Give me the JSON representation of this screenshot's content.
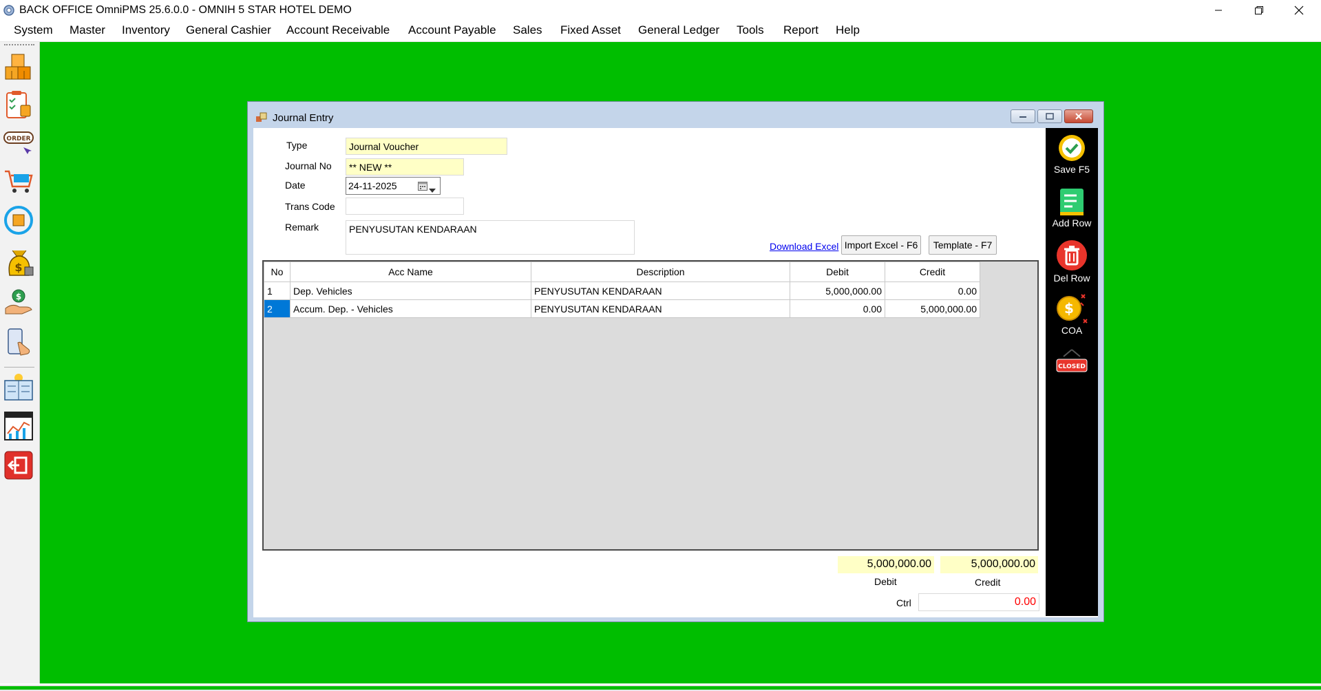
{
  "window": {
    "title": "BACK OFFICE OmniPMS 25.6.0.0 - OMNIH 5 STAR HOTEL DEMO"
  },
  "menu": [
    "System",
    "Master",
    "Inventory",
    "General Cashier",
    "Account Receivable",
    "Account Payable",
    "Sales",
    "Fixed Asset",
    "General Ledger",
    "Tools",
    "Report",
    "Help"
  ],
  "toolbar_icons": [
    "inventory-boxes-icon",
    "clipboard-checklist-icon",
    "order-icon",
    "shopping-cart-icon",
    "cycle-box-icon",
    "money-bag-icon",
    "hand-money-icon",
    "mobile-tap-icon",
    "ledger-book-icon",
    "chart-report-icon",
    "logout-icon"
  ],
  "journal": {
    "title": "Journal Entry",
    "labels": {
      "type": "Type",
      "journal_no": "Journal No",
      "date": "Date",
      "trans_code": "Trans Code",
      "remark": "Remark"
    },
    "values": {
      "type": "Journal Voucher",
      "journal_no": "** NEW **",
      "date": "24-11-2025",
      "trans_code": "",
      "remark": "PENYUSUTAN KENDARAAN"
    },
    "download_link": "Download Excel",
    "import_button": "Import Excel - F6",
    "template_button": "Template - F7",
    "grid": {
      "columns": [
        "No",
        "Acc Name",
        "Description",
        "Debit",
        "Credit"
      ],
      "rows": [
        {
          "no": "1",
          "acc_name": "Dep. Vehicles",
          "description": "PENYUSUTAN KENDARAAN",
          "debit": "5,000,000.00",
          "credit": "0.00"
        },
        {
          "no": "2",
          "acc_name": "Accum. Dep. - Vehicles",
          "description": "PENYUSUTAN KENDARAAN",
          "debit": "0.00",
          "credit": "5,000,000.00"
        }
      ]
    },
    "totals": {
      "debit_value": "5,000,000.00",
      "credit_value": "5,000,000.00",
      "debit_label": "Debit",
      "credit_label": "Credit",
      "ctrl_label": "Ctrl",
      "ctrl_value": "0.00"
    },
    "actions": {
      "save": "Save F5",
      "add_row": "Add Row",
      "del_row": "Del Row",
      "coa": "COA",
      "closed_badge": "CLOSED"
    }
  },
  "colors": {
    "desktop": "#00be00",
    "field_highlight": "#ffffc6",
    "selection": "#0078d7",
    "ctrl_value": "#ff0000",
    "action_panel": "#000000"
  }
}
